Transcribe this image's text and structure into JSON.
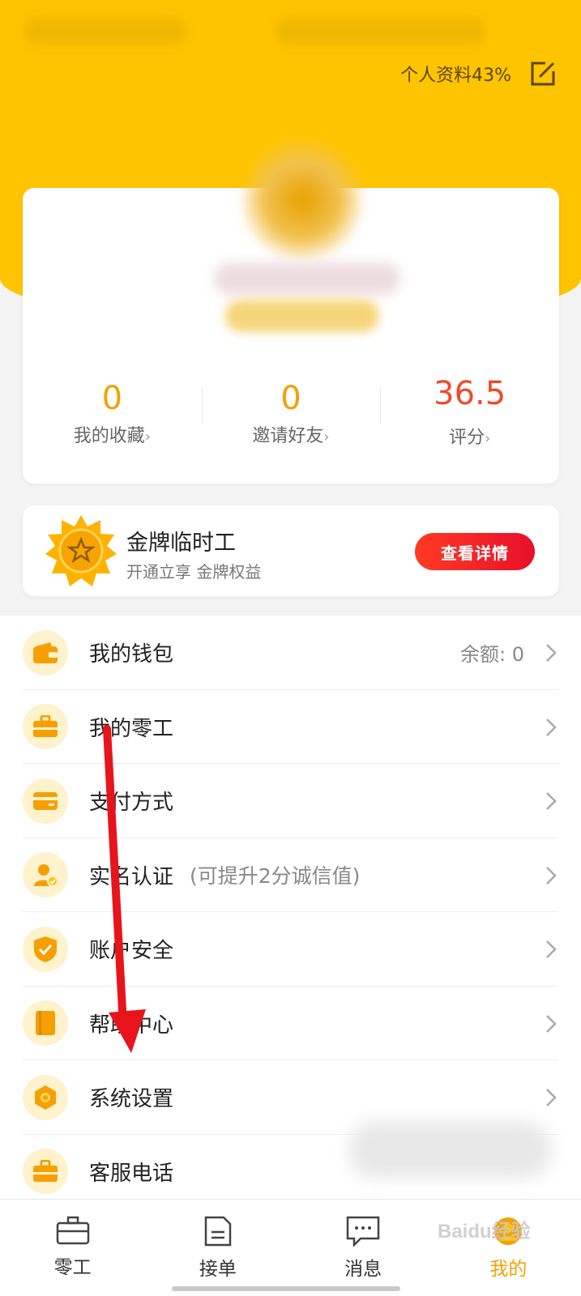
{
  "header": {
    "profile_completion": "个人资料43%",
    "colors": {
      "brand": "#ffc400",
      "accent": "#f5a000",
      "danger": "#f04a2a"
    }
  },
  "stats": [
    {
      "value": "0",
      "label": "我的收藏"
    },
    {
      "value": "0",
      "label": "邀请好友"
    },
    {
      "value": "36.5",
      "label": "评分"
    }
  ],
  "gold": {
    "title": "金牌临时工",
    "subtitle": "开通立享 金牌权益",
    "button": "查看详情"
  },
  "menu": [
    {
      "label": "我的钱包",
      "right": "余额: 0",
      "icon": "wallet-icon"
    },
    {
      "label": "我的零工",
      "icon": "briefcase-icon"
    },
    {
      "label": "支付方式",
      "icon": "card-icon"
    },
    {
      "label": "实名认证",
      "hint": "(可提升2分诚信值)",
      "icon": "id-verify-icon"
    },
    {
      "label": "账户安全",
      "icon": "shield-icon"
    },
    {
      "label": "帮助中心",
      "icon": "book-icon"
    },
    {
      "label": "系统设置",
      "icon": "settings-icon"
    },
    {
      "label": "客服电话",
      "icon": "phone-briefcase-icon"
    }
  ],
  "tabs": [
    {
      "label": "零工",
      "icon": "briefcase-icon"
    },
    {
      "label": "接单",
      "icon": "document-icon"
    },
    {
      "label": "消息",
      "icon": "chat-icon"
    },
    {
      "label": "我的",
      "icon": "profile-icon",
      "active": true
    }
  ],
  "watermark": "Baidu经验"
}
